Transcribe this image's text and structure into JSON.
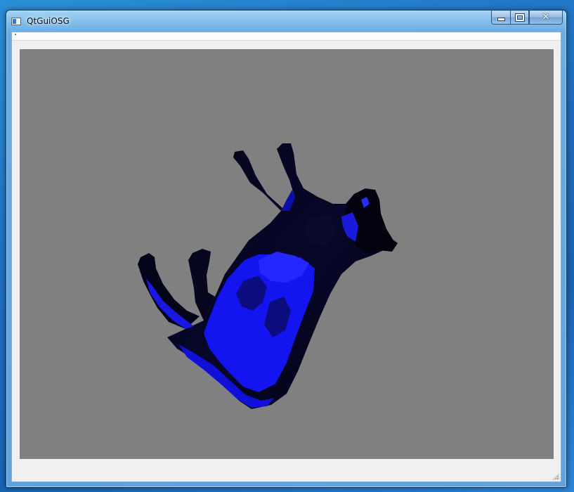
{
  "window": {
    "title": "QtGuiOSG",
    "icon": "qt-app-icon",
    "caption_buttons": {
      "minimize": "minimize-icon",
      "maximize": "maximize-icon",
      "close": "✕"
    }
  },
  "viewport": {
    "background_color": "#808080",
    "model_color": "#1a1aff",
    "model_shadow_color": "#05051a"
  }
}
